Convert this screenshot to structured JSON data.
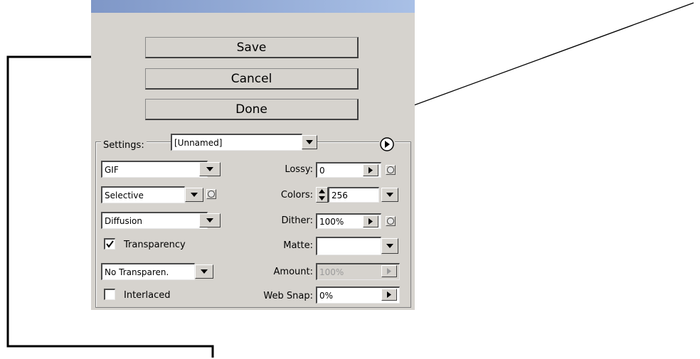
{
  "buttons": {
    "save": "Save",
    "cancel": "Cancel",
    "done": "Done"
  },
  "settings": {
    "label": "Settings:",
    "preset": "[Unnamed]",
    "format": "GIF",
    "reduction": "Selective",
    "dither_algorithm": "Diffusion",
    "transparency_label": "Transparency",
    "transparency_checked": true,
    "transparency_dither": "No Transparen.",
    "interlaced_label": "Interlaced",
    "interlaced_checked": false,
    "lossy_label": "Lossy:",
    "lossy_value": "0",
    "colors_label": "Colors:",
    "colors_value": "256",
    "dither_label": "Dither:",
    "dither_value": "100%",
    "matte_label": "Matte:",
    "matte_value": "",
    "amount_label": "Amount:",
    "amount_value": "100%",
    "websnap_label": "Web Snap:",
    "websnap_value": "0%"
  },
  "icons": {
    "dropdown": "triangle-down",
    "spinner": "triangle-right",
    "menu": "circle-play",
    "stepper": "up-down"
  },
  "colors": {
    "panel": "#d6d3ce",
    "titlebar": "#8fa8d8",
    "annotation": "#000000"
  }
}
